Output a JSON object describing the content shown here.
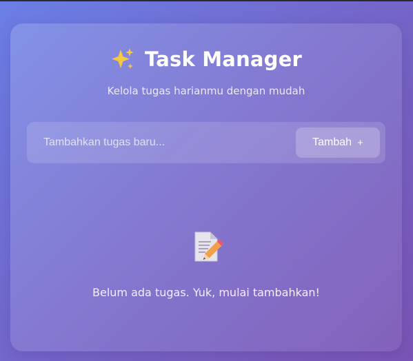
{
  "app": {
    "title": "Task Manager",
    "subtitle": "Kelola tugas harianmu dengan mudah",
    "title_icon": "sparkles-icon"
  },
  "input": {
    "placeholder": "Tambahkan tugas baru...",
    "value": ""
  },
  "add_button": {
    "label": "Tambah",
    "icon": "+"
  },
  "empty_state": {
    "icon": "memo-pencil-icon",
    "message": "Belum ada tugas. Yuk, mulai tambahkan!"
  },
  "colors": {
    "background_start": "#6a7fe6",
    "background_end": "#7a55b5",
    "text": "#ffffff",
    "sparkle": "#f7c843"
  }
}
